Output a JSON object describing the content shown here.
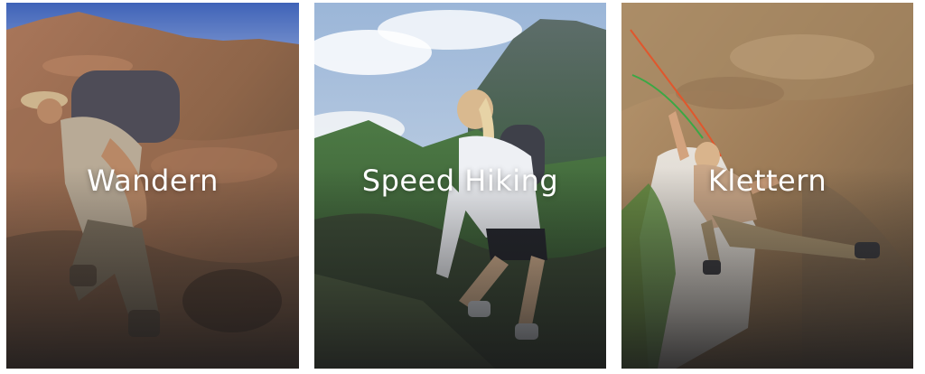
{
  "categories": [
    {
      "label": "Wandern"
    },
    {
      "label": "Speed Hiking"
    },
    {
      "label": "Klettern"
    }
  ]
}
